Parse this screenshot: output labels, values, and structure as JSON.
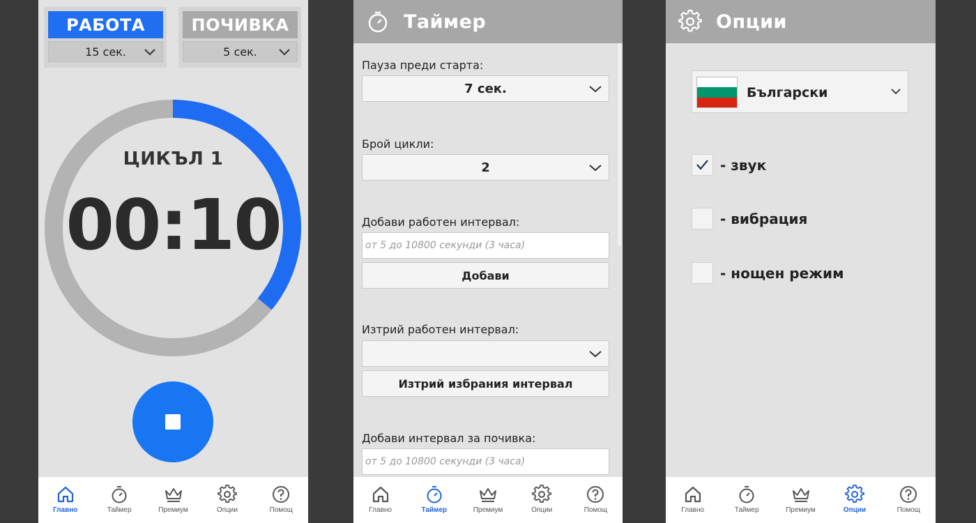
{
  "colors": {
    "accent": "#1f6ff0",
    "stop_button": "#1876f2",
    "ring_track": "#b3b3b3",
    "ring_progress": "#1e6cf2",
    "header_bg": "#a7a7a7",
    "screen_bg": "#e2e2e2"
  },
  "main": {
    "work": {
      "title": "РАБОТА",
      "duration": "15 сек."
    },
    "rest": {
      "title": "ПОЧИВКА",
      "duration": "5 сек."
    },
    "cycle_label": "ЦИКЪЛ 1",
    "time": "00:10",
    "ring_progress_fraction": 0.36,
    "stop_icon": "stop-icon"
  },
  "nav": {
    "home": "Главно",
    "timer": "Таймер",
    "premium": "Премиум",
    "options": "Опции",
    "help": "Помощ"
  },
  "timer": {
    "title": "Таймер",
    "pause_label": "Пауза преди старта:",
    "pause_value": "7 сек.",
    "cycles_label": "Брой цикли:",
    "cycles_value": "2",
    "add_work_label": "Добави работен интервал:",
    "add_work_placeholder": "от 5 до 10800 секунди (3 часа)",
    "add_button": "Добави",
    "delete_work_label": "Изтрий работен интервал:",
    "delete_value": "",
    "delete_button": "Изтрий избрания интервал",
    "add_rest_label": "Добави интервал за почивка:",
    "add_rest_placeholder": "от 5 до 10800 секунди (3 часа)"
  },
  "options": {
    "title": "Опции",
    "language": "Български",
    "flag_icon": "bulgaria-flag-icon",
    "sound": {
      "label": "- звук",
      "checked": true
    },
    "vibration": {
      "label": "- вибрация",
      "checked": false
    },
    "night": {
      "label": "- нощен режим",
      "checked": false
    }
  }
}
